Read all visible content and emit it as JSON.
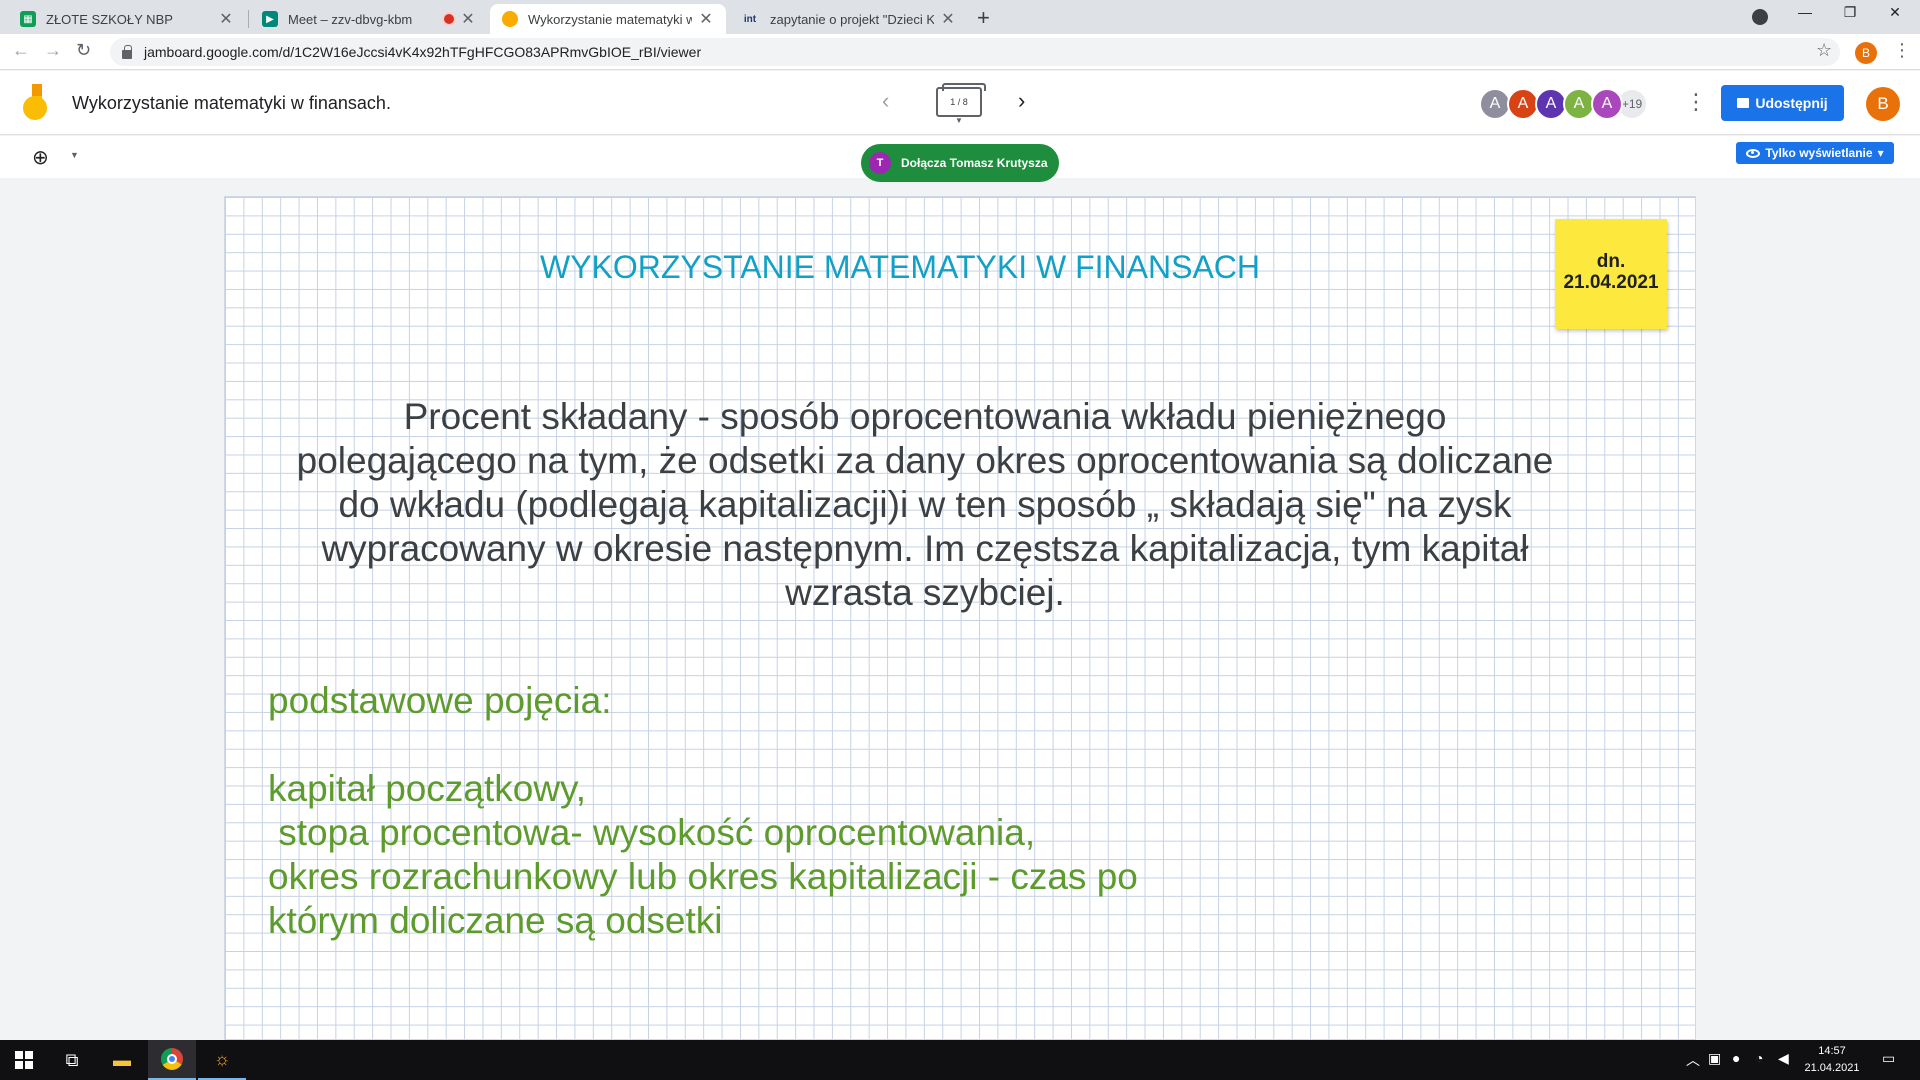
{
  "browser": {
    "tabs": [
      {
        "title": "ZŁOTE SZKOŁY NBP",
        "favicon": "sheets-icon",
        "color": "#0f9d58"
      },
      {
        "title": "Meet – zzv-dbvg-kbm",
        "favicon": "meet-icon",
        "color": "#00897b"
      },
      {
        "title": "Wykorzystanie matematyki w fin",
        "favicon": "jamboard-icon",
        "color": "#f9ab00"
      },
      {
        "title": "zapytanie o projekt \"Dzieci Kapit",
        "favicon": "int-icon",
        "favicon_text": "int",
        "color": "#1a3d6e"
      }
    ],
    "new_tab": "+",
    "url": "jamboard.google.com/d/1C2W16eJccsi4vK4x92hTFgHFCGO83APRmvGbIOE_rBI/viewer",
    "profile_initial": "B"
  },
  "app": {
    "doc_title": "Wykorzystanie matematyki w finansach.",
    "frame_indicator": "1 / 8",
    "collaborators": [
      {
        "initial": "A",
        "color": "#8e8e9e"
      },
      {
        "initial": "A",
        "color": "#d84315"
      },
      {
        "initial": "A",
        "color": "#5e35b1"
      },
      {
        "initial": "A",
        "color": "#7cb342"
      },
      {
        "initial": "A",
        "color": "#ab47bc"
      }
    ],
    "more_collaborators": "+19",
    "share_label": "Udostępnij",
    "user_initial": "B",
    "join_toast": {
      "initial": "T",
      "text": "Dołącza Tomasz Krutysza"
    },
    "view_only_label": "Tylko wyświetlanie"
  },
  "frame": {
    "title": "WYKORZYSTANIE MATEMATYKI W FINANSACH",
    "sticky_note": [
      "dn.",
      "21.04.2021"
    ],
    "definition": "Procent składany - sposób oprocentowania wkładu pieniężnego polegającego na tym, że odsetki za dany okres oprocentowania są doliczane do wkładu (podlegają kapitalizacji)i w ten sposób „ składają się\" na zysk wypracowany w okresie następnym. Im częstsza kapitalizacja, tym kapitał wzrasta szybciej.",
    "concepts_heading": "podstawowe pojęcia:",
    "concepts_lines": [
      "kapitał początkowy,",
      " stopa procentowa- wysokość oprocentowania,",
      "okres rozrachunkowy lub okres kapitalizacji - czas po",
      "którym doliczane są odsetki"
    ],
    "colors": {
      "title": "#12a0c6",
      "definition": "#3c4043",
      "concepts": "#5d9b2d",
      "sticky": "#fde93d"
    }
  },
  "taskbar": {
    "time": "14:57",
    "date": "21.04.2021"
  }
}
